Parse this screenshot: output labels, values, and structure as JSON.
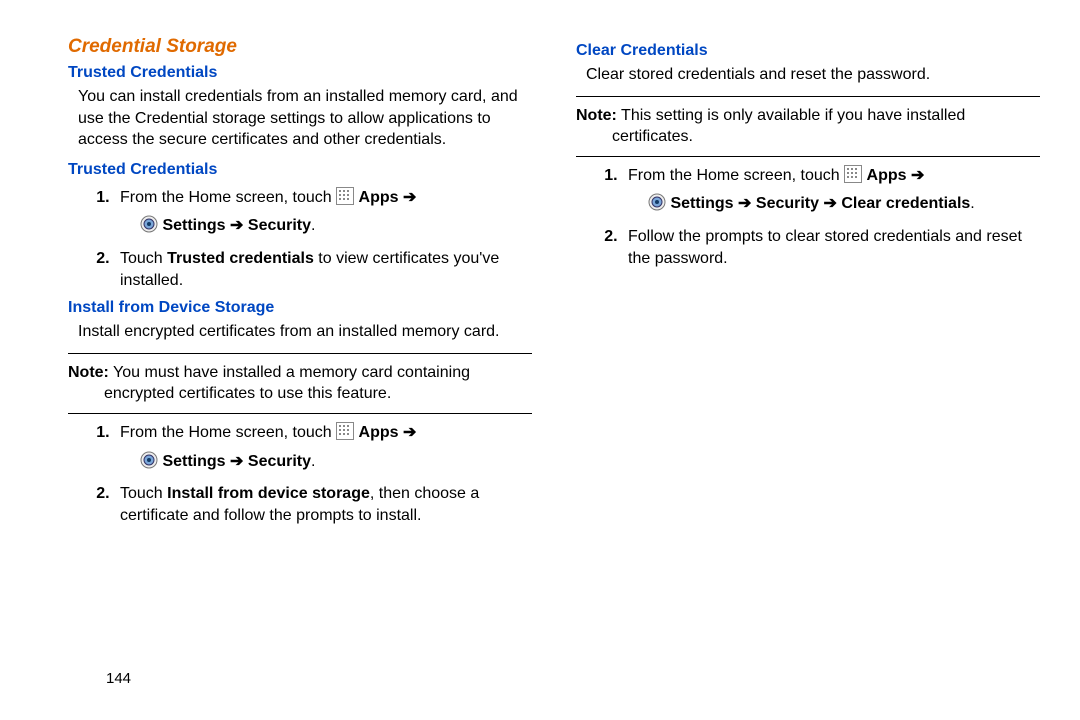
{
  "pageNumber": "144",
  "left": {
    "sectionTitle": "Credential Storage",
    "sub1": "Trusted Credentials",
    "para1": "You can install credentials from an installed memory card, and use the Credential storage settings to allow applications to access the secure certificates and other credentials.",
    "sub2": "Trusted Credentials",
    "step1a": "From the Home screen, touch ",
    "appsLabel": "Apps",
    "arrow": " ➔",
    "settingsLabel": "Settings",
    "securityLabel": "Security",
    "step2a_pre": "Touch ",
    "step2a_bold": "Trusted credentials",
    "step2a_post": " to view certificates you've installed.",
    "sub3": "Install from Device Storage",
    "para2": "Install encrypted certificates from an installed memory card.",
    "noteLabel": "Note:",
    "note1": " You must have installed a memory card containing",
    "note1b": "encrypted certificates to use this feature.",
    "step3_2_pre": "Touch ",
    "step3_2_bold": "Install from device storage",
    "step3_2_post": ", then choose a certificate and follow the prompts to install."
  },
  "right": {
    "sub1": "Clear Credentials",
    "para1": "Clear stored credentials and reset the password.",
    "noteLabel": "Note:",
    "note1": " This setting is only available if you have installed",
    "note1b": "certificates.",
    "clearCredLabel": "Clear credentials",
    "step2": "Follow the prompts to clear stored credentials and reset the password."
  }
}
